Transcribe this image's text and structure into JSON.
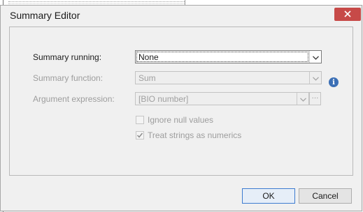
{
  "dialog": {
    "title": "Summary Editor"
  },
  "form": {
    "summary_running_label": "Summary running:",
    "summary_running_value": "None",
    "summary_function_label": "Summary function:",
    "summary_function_value": "Sum",
    "argument_expression_label": "Argument expression:",
    "argument_expression_value": "[BIO number]",
    "ignore_null_label": "Ignore null values",
    "ignore_null_checked": false,
    "treat_strings_label": "Treat strings as numerics",
    "treat_strings_checked": true,
    "info_icon_glyph": "i"
  },
  "buttons": {
    "ok": "OK",
    "cancel": "Cancel",
    "ellipsis": "···"
  },
  "colors": {
    "close_button": "#c74a48",
    "info_icon": "#3b6fb5",
    "default_button_border": "#3d7bd0"
  }
}
